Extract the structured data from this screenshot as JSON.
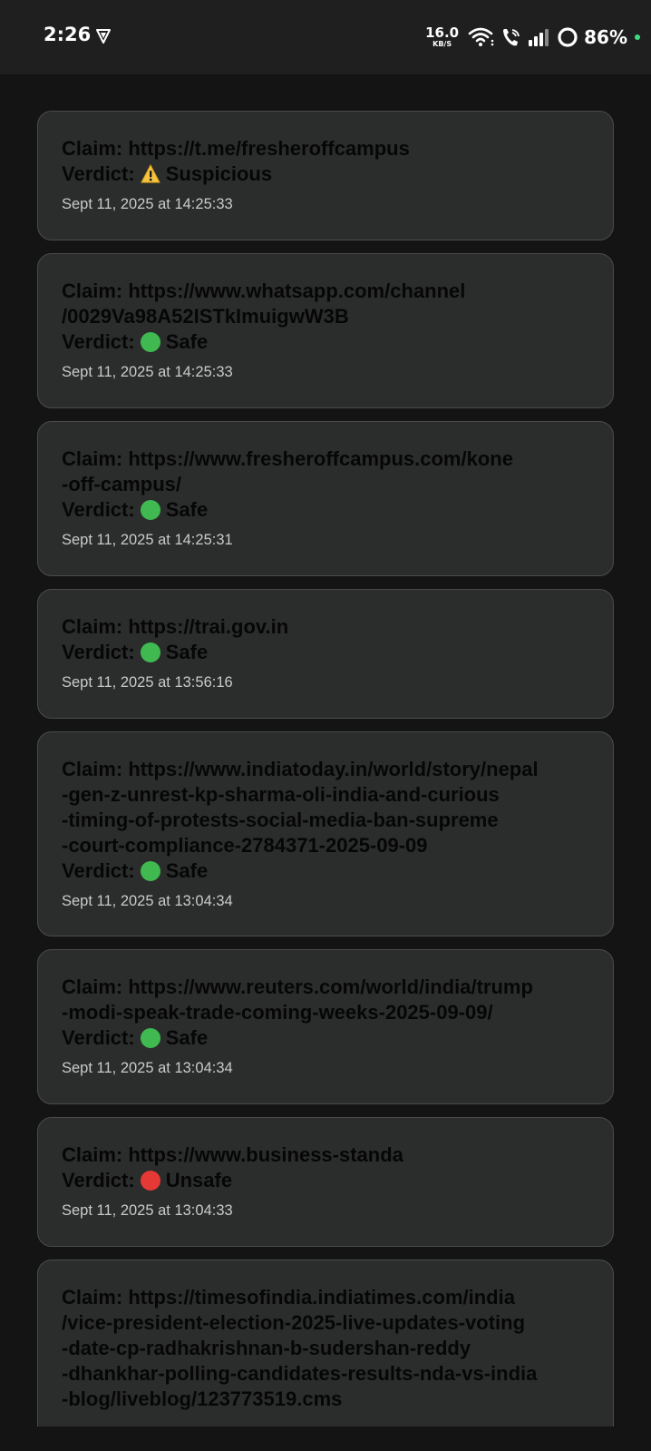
{
  "status_bar": {
    "time": "2:26",
    "net_speed": "16.0",
    "net_unit": "KB/S",
    "battery": "86%"
  },
  "claims": [
    {
      "claim": "Claim: https://t.me/fresheroffcampus",
      "verdict_label": "Verdict:",
      "verdict": "Suspicious",
      "verdict_icon": "warning-icon",
      "timestamp": "Sept 11, 2025 at 14:25:33"
    },
    {
      "claim": "Claim: https://www.whatsapp.com/channel\n/0029Va98A52ISTkImuigwW3B",
      "verdict_label": "Verdict:",
      "verdict": "Safe",
      "verdict_icon": "green-circle-icon",
      "timestamp": "Sept 11, 2025 at 14:25:33"
    },
    {
      "claim": "Claim: https://www.fresheroffcampus.com/kone\n-off-campus/",
      "verdict_label": "Verdict:",
      "verdict": "Safe",
      "verdict_icon": "green-circle-icon",
      "timestamp": "Sept 11, 2025 at 14:25:31"
    },
    {
      "claim": "Claim: https://trai.gov.in",
      "verdict_label": "Verdict:",
      "verdict": "Safe",
      "verdict_icon": "green-circle-icon",
      "timestamp": "Sept 11, 2025 at 13:56:16"
    },
    {
      "claim": "Claim: https://www.indiatoday.in/world/story/nepal\n-gen-z-unrest-kp-sharma-oli-india-and-curious\n-timing-of-protests-social-media-ban-supreme\n-court-compliance-2784371-2025-09-09",
      "verdict_label": "Verdict:",
      "verdict": "Safe",
      "verdict_icon": "green-circle-icon",
      "timestamp": "Sept 11, 2025 at 13:04:34"
    },
    {
      "claim": "Claim: https://www.reuters.com/world/india/trump\n-modi-speak-trade-coming-weeks-2025-09-09/",
      "verdict_label": "Verdict:",
      "verdict": "Safe",
      "verdict_icon": "green-circle-icon",
      "timestamp": "Sept 11, 2025 at 13:04:34"
    },
    {
      "claim": "Claim: https://www.business-standa",
      "verdict_label": "Verdict:",
      "verdict": "Unsafe",
      "verdict_icon": "red-circle-icon",
      "timestamp": "Sept 11, 2025 at 13:04:33"
    },
    {
      "claim": "Claim: https://timesofindia.indiatimes.com/india\n/vice-president-election-2025-live-updates-voting\n-date-cp-radhakrishnan-b-sudershan-reddy\n-dhankhar-polling-candidates-results-nda-vs-india\n-blog/liveblog/123773519.cms",
      "verdict_label": "",
      "verdict": "",
      "verdict_icon": "",
      "timestamp": ""
    }
  ],
  "colors": {
    "background": "#141414",
    "card": "#2b2d2c",
    "card_border": "#4a4c4b",
    "text_dark": "#060606",
    "timestamp": "#c9cbca",
    "safe": "#3fb950",
    "unsafe": "#e53935",
    "warning": "#f5c542"
  }
}
